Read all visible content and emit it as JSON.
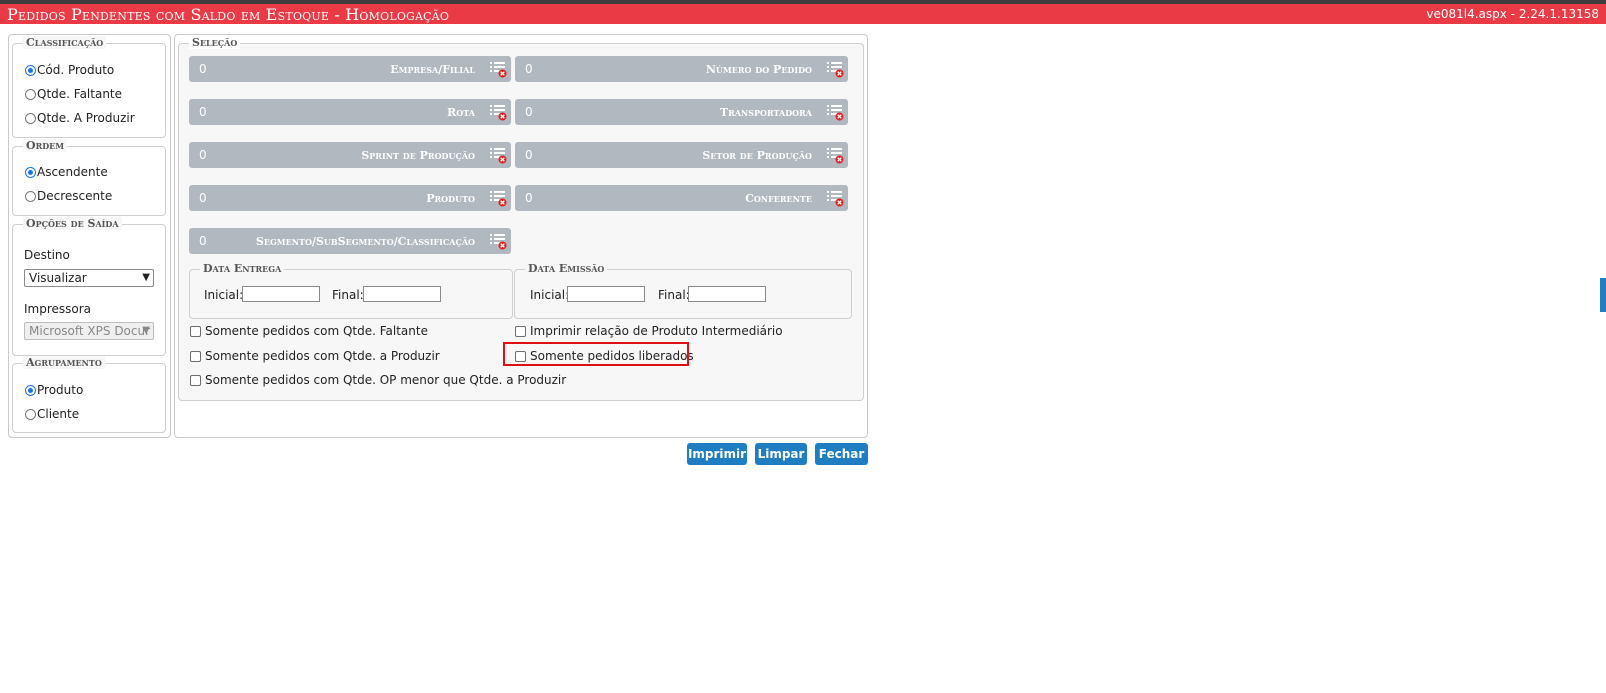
{
  "header": {
    "title": "Pedidos Pendentes com Saldo em Estoque  - Homologação",
    "version": "ve081l4.aspx - 2.24.1.13158"
  },
  "sidebar": {
    "classificacao": {
      "legend": "Classificação",
      "options": [
        {
          "label": "Cód. Produto",
          "checked": true
        },
        {
          "label": "Qtde. Faltante",
          "checked": false
        },
        {
          "label": "Qtde. A Produzir",
          "checked": false
        }
      ]
    },
    "ordem": {
      "legend": "Ordem",
      "options": [
        {
          "label": "Ascendente",
          "checked": true
        },
        {
          "label": "Decrescente",
          "checked": false
        }
      ]
    },
    "opcoes_saida": {
      "legend": "Opções de Saída",
      "destino_label": "Destino",
      "destino_value": "Visualizar",
      "impressora_label": "Impressora",
      "impressora_value": "Microsoft XPS Docur"
    },
    "agrupamento": {
      "legend": "Agrupamento",
      "options": [
        {
          "label": "Produto",
          "checked": true
        },
        {
          "label": "Cliente",
          "checked": false
        }
      ]
    }
  },
  "selecao": {
    "legend": "Seleção",
    "filters": [
      {
        "value": "0",
        "label": "Empresa/Filial"
      },
      {
        "value": "0",
        "label": "Número do Pedido"
      },
      {
        "value": "0",
        "label": "Rota"
      },
      {
        "value": "0",
        "label": "Transportadora"
      },
      {
        "value": "0",
        "label": "Sprint de Produção"
      },
      {
        "value": "0",
        "label": "Setor de Produção"
      },
      {
        "value": "0",
        "label": "Produto"
      },
      {
        "value": "0",
        "label": "Conferente"
      },
      {
        "value": "0",
        "label": "Segmento/SubSegmento/Classificação"
      }
    ],
    "data_entrega": {
      "legend": "Data Entrega",
      "inicial_label": "Inicial:",
      "final_label": "Final:",
      "inicial_value": "",
      "final_value": ""
    },
    "data_emissao": {
      "legend": "Data Emissão",
      "inicial_label": "Inicial:",
      "final_label": "Final:",
      "inicial_value": "",
      "final_value": ""
    },
    "checkboxes": [
      {
        "label": "Somente pedidos com Qtde. Faltante",
        "checked": false
      },
      {
        "label": "Imprimir relação de Produto Intermediário",
        "checked": false
      },
      {
        "label": "Somente pedidos com Qtde. a Produzir",
        "checked": false
      },
      {
        "label": "Somente pedidos liberados",
        "checked": false
      },
      {
        "label": "Somente pedidos com Qtde. OP menor que Qtde. a Produzir",
        "checked": false
      }
    ]
  },
  "buttons": {
    "imprimir": "Imprimir",
    "limpar": "Limpar",
    "fechar": "Fechar"
  },
  "colors": {
    "title_bar": "#ea3a45",
    "selection_bar": "#b2b8c0",
    "button": "#1f7ec2",
    "highlight": "#e01010"
  },
  "icons": {
    "filter_clear": "list-clear-icon"
  }
}
